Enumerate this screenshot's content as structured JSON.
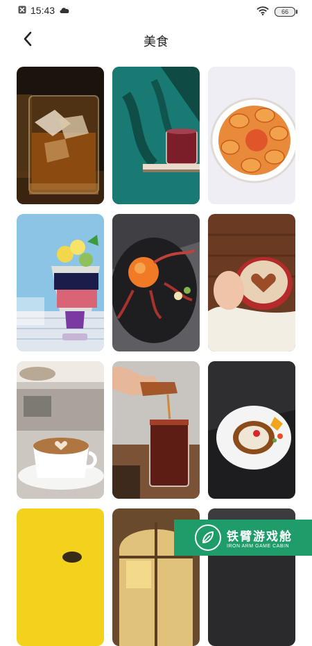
{
  "status_bar": {
    "time": "15:43",
    "battery": "66",
    "icons": [
      "notification-x-icon",
      "cloud-icon",
      "wifi-icon",
      "battery-icon"
    ]
  },
  "header": {
    "title": "美食",
    "back_icon": "chevron-left-icon"
  },
  "gallery": {
    "items": [
      {
        "name": "whiskey-glass"
      },
      {
        "name": "drink-on-shelf"
      },
      {
        "name": "crab-platter"
      },
      {
        "name": "fruit-parfait"
      },
      {
        "name": "crab-plate"
      },
      {
        "name": "latte-heart-art"
      },
      {
        "name": "cafe-latte"
      },
      {
        "name": "iced-tea-pour"
      },
      {
        "name": "dessert-plate"
      },
      {
        "name": "yellow-dessert"
      },
      {
        "name": "stained-glass-window"
      },
      {
        "name": "dark-photo"
      }
    ]
  },
  "ad_banner": {
    "title_cn": "铁臂游戏舱",
    "title_en": "IRON ARM GAME CABIN"
  }
}
